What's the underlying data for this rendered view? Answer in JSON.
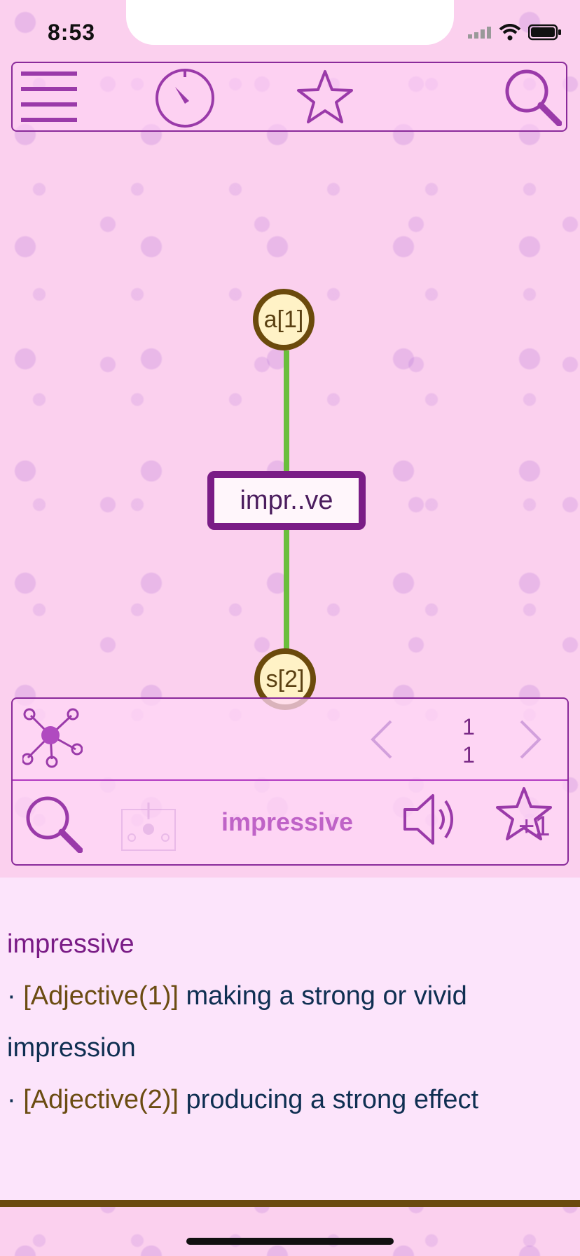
{
  "status": {
    "time": "8:53"
  },
  "toolbar": {
    "menu_icon": "hamburger-menu-icon",
    "timer_icon": "timer-icon",
    "favorite_icon": "star-icon",
    "search_icon": "search-icon",
    "accent": "#8a2a9a"
  },
  "graph": {
    "node_top": "a[1]",
    "word": "impr..ve",
    "node_bottom": "s[2]",
    "edge_color": "#6abe3c"
  },
  "panel": {
    "network_icon": "network-icon",
    "prev_icon": "chevron-left-icon",
    "next_icon": "chevron-right-icon",
    "page_current": "1",
    "page_total": "1",
    "search_icon": "search-icon",
    "import_icon": "graph-import-icon",
    "word": "impressive",
    "speaker_icon": "speaker-icon",
    "star_plus_label": "+1"
  },
  "definition": {
    "title": "impressive",
    "entries": [
      {
        "bullet": "· ",
        "tag": "[Adjective(1)]",
        "text": " making a strong or vivid impression"
      },
      {
        "bullet": "· ",
        "tag": "[Adjective(2)]",
        "text": " producing a strong effect"
      }
    ]
  }
}
